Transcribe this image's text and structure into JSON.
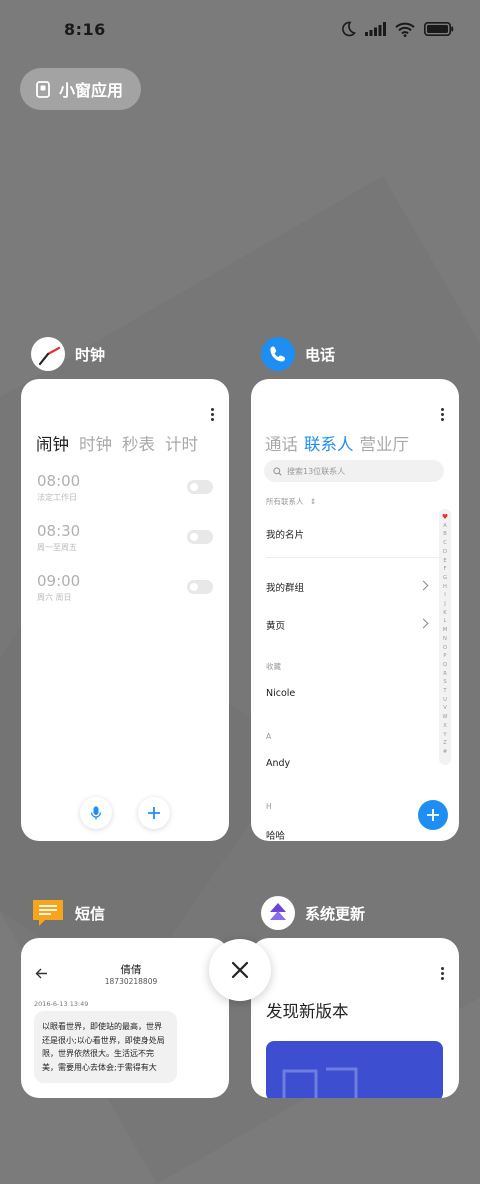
{
  "status_bar": {
    "time": "8:16"
  },
  "floating_window_button": {
    "label": "小窗应用"
  },
  "apps": {
    "clock": {
      "name": "时钟",
      "tabs": [
        "闹钟",
        "时钟",
        "秒表",
        "计时"
      ],
      "alarms": [
        {
          "time": "08:00",
          "subtitle": "法定工作日"
        },
        {
          "time": "08:30",
          "subtitle": "周一至周五"
        },
        {
          "time": "09:00",
          "subtitle": "周六 周日"
        }
      ]
    },
    "phone": {
      "name": "电话",
      "tabs": [
        "通话",
        "联系人",
        "营业厅"
      ],
      "search_placeholder": "搜索13位联系人",
      "filter": "所有联系人",
      "my_card": "我的名片",
      "my_groups": "我的群组",
      "yellow_pages": "黄页",
      "section_favorites": "收藏",
      "contact_1": "Nicole",
      "section_a": "A",
      "contact_2": "Andy",
      "section_h": "H",
      "contact_3": "哈哈",
      "alphabet": [
        "A",
        "B",
        "C",
        "D",
        "E",
        "F",
        "G",
        "H",
        "I",
        "J",
        "K",
        "L",
        "M",
        "N",
        "O",
        "P",
        "Q",
        "R",
        "S",
        "T",
        "U",
        "V",
        "W",
        "X",
        "Y",
        "Z",
        "#"
      ]
    },
    "sms": {
      "name": "短信",
      "contact_name": "倩倩",
      "contact_number": "18730218809",
      "date": "2016-6-13 13:49",
      "message": "以眼看世界，即使站的最高，世界还是很小;以心看世界，即使身处局限，世界依然很大。生活远不完美，需要用心去体会;于需得有大"
    },
    "update": {
      "name": "系统更新",
      "title": "发现新版本"
    }
  },
  "colors": {
    "accent_blue": "#1e8ef2",
    "background_gray": "#7b7b7b"
  }
}
